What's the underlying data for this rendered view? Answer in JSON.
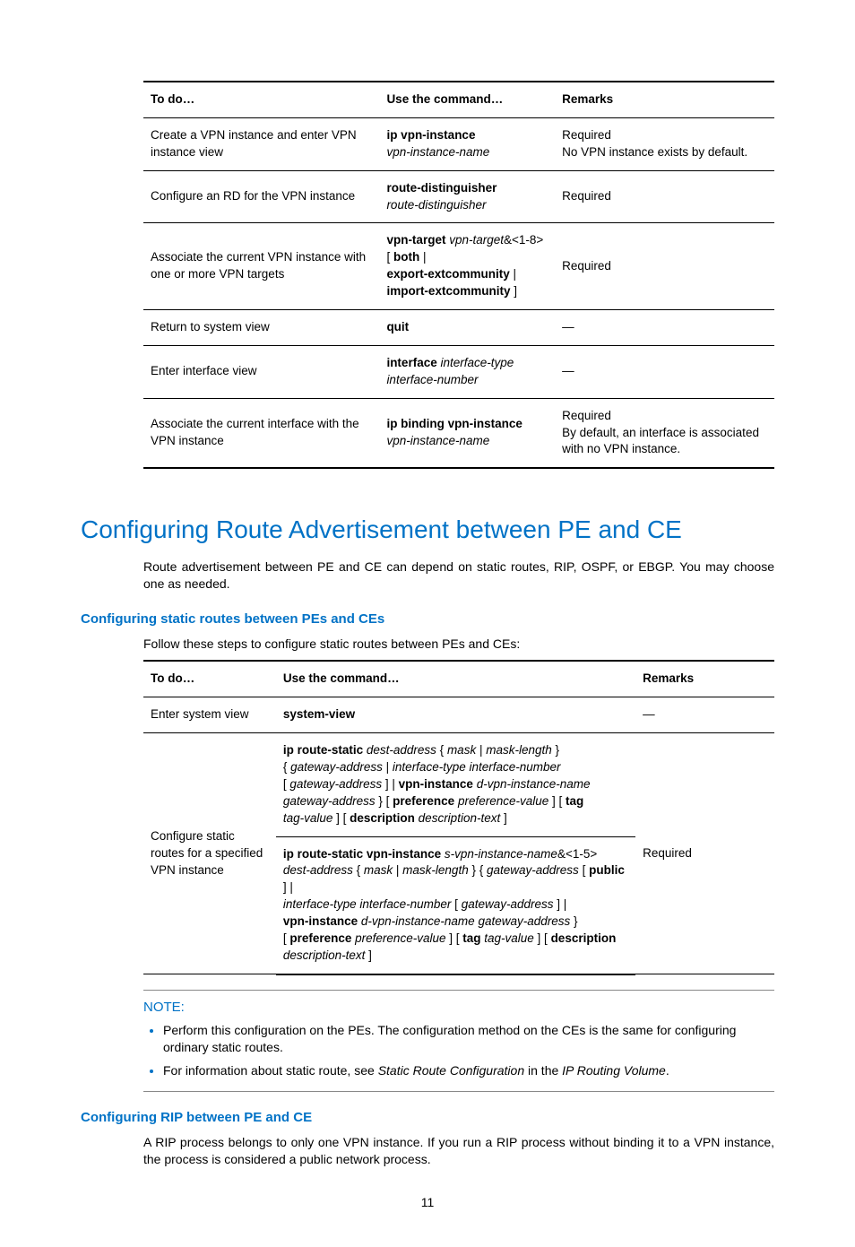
{
  "table1": {
    "headers": [
      "To do…",
      "Use the command…",
      "Remarks"
    ],
    "rows": [
      {
        "todo": "Create a VPN instance and enter VPN instance view",
        "cmd_bold": "ip vpn-instance",
        "cmd_italic": "vpn-instance-name",
        "remarks_l1": "Required",
        "remarks_l2": "No VPN instance exists by default."
      },
      {
        "todo": "Configure an RD for the VPN instance",
        "cmd_bold": "route-distinguisher",
        "cmd_italic": "route-distinguisher",
        "remarks": "Required"
      },
      {
        "todo": "Associate the current VPN instance with one or more VPN targets",
        "remarks": "Required"
      },
      {
        "todo": "Return to system view",
        "cmd_bold": "quit",
        "remarks": "—"
      },
      {
        "todo": "Enter interface view",
        "cmd_bold": "interface",
        "cmd_italic": "interface-type interface-number",
        "remarks": "—"
      },
      {
        "todo": "Associate the current interface with the VPN instance",
        "cmd_bold": "ip binding vpn-instance",
        "cmd_italic": "vpn-instance-name",
        "remarks_l1": "Required",
        "remarks_l2": "By default, an interface is associated with no VPN instance."
      }
    ],
    "row3_cmd": {
      "p1_bold": "vpn-target",
      "p1_italic": "vpn-target",
      "p2": "&<1-8>",
      "p3": "[ ",
      "p3_bold": "both",
      "p4": " |",
      "p5_bold": "export-extcommunity",
      "p6": " |",
      "p7_bold": "import-extcommunity",
      "p8": " ]"
    }
  },
  "section_heading": "Configuring Route Advertisement between PE and CE",
  "section_para": "Route advertisement between PE and CE can depend on static routes, RIP, OSPF, or EBGP. You may choose one as needed.",
  "sub1_heading": "Configuring static routes between PEs and CEs",
  "sub1_intro": "Follow these steps to configure static routes between PEs and CEs:",
  "table2": {
    "headers": [
      "To do…",
      "Use the command…",
      "Remarks"
    ],
    "row1": {
      "todo": "Enter system view",
      "cmd": "system-view",
      "remarks": "—"
    },
    "row2": {
      "todo": "Configure static routes for a specified VPN instance",
      "remarks": "Required",
      "cmd_a": {
        "a1": "ip route-static",
        "a2": "dest-address",
        "a3": "{ ",
        "a4": "mask",
        "a5": " | ",
        "a6": "mask-length",
        "a7": " }",
        "b1": "{ ",
        "b2": "gateway-address",
        "b3": " | ",
        "b4": "interface-type interface-number",
        "c1": "[ ",
        "c2": "gateway-address",
        "c3": " ] | ",
        "c4": "vpn-instance",
        "c5": "d-vpn-instance-name",
        "d1": "gateway-address",
        "d2": " } [ ",
        "d3": "preference",
        "d4": "preference-value",
        "d5": " ] [ ",
        "d6": "tag",
        "e1": "tag-value",
        "e2": " ] [ ",
        "e3": "description",
        "e4": "description-text",
        "e5": " ]"
      },
      "cmd_b": {
        "a1": "ip route-static vpn-instance",
        "a2": "s-vpn-instance-name",
        "a3": "&<1-5>",
        "b1": "dest-address",
        "b2": " { ",
        "b3": "mask",
        "b4": " | ",
        "b5": "mask-length",
        "b6": " } { ",
        "b7": "gateway-address",
        "b8": " [ ",
        "b9": "public",
        "b10": " ] |",
        "c1": "interface-type interface-number",
        "c2": " [ ",
        "c3": "gateway-address",
        "c4": " ] |",
        "d1": "vpn-instance",
        "d2": "d-vpn-instance-name gateway-address",
        "d3": " }",
        "e1": "[ ",
        "e2": "preference",
        "e3": "preference-value",
        "e4": " ] [ ",
        "e5": "tag",
        "e6": "tag-value",
        "e7": " ] [ ",
        "e8": "description",
        "f1": "description-text",
        "f2": " ]"
      }
    }
  },
  "note": {
    "label": "NOTE:",
    "items": [
      "Perform this configuration on the PEs. The configuration method on the CEs is the same for configuring ordinary static routes.",
      "For information about static route, see "
    ],
    "item2_i1": "Static Route Configuration",
    "item2_mid": " in the ",
    "item2_i2": "IP Routing Volume",
    "item2_end": "."
  },
  "sub2_heading": "Configuring RIP between PE and CE",
  "sub2_para": "A RIP process belongs to only one VPN instance. If you run a RIP process without binding it to a VPN instance, the process is considered a public network process.",
  "page_number": "11"
}
